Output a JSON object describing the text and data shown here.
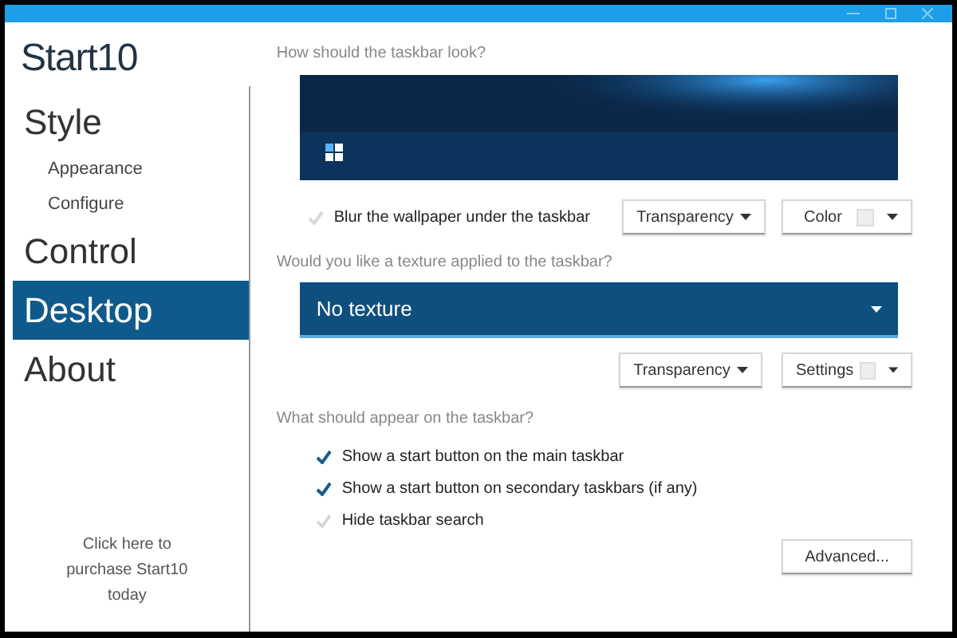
{
  "logo": {
    "text": "Start10"
  },
  "sidebar": {
    "items": [
      {
        "label": "Style",
        "selected": false,
        "children": [
          {
            "label": "Appearance"
          },
          {
            "label": "Configure"
          }
        ]
      },
      {
        "label": "Control",
        "selected": false
      },
      {
        "label": "Desktop",
        "selected": true
      },
      {
        "label": "About",
        "selected": false
      }
    ],
    "purchase_link": "Click here to purchase Start10 today"
  },
  "sections": [
    {
      "question": "How should the taskbar look?",
      "preview": {
        "kind": "picture"
      },
      "options": [
        {
          "label": "Blur the wallpaper under the taskbar",
          "checked": false
        }
      ],
      "dropdowns": [
        {
          "label": "Transparency",
          "swatch": false
        },
        {
          "label": "Color",
          "swatch": true
        }
      ]
    },
    {
      "question": "Would you like a texture applied to the taskbar?",
      "select": {
        "value": "No texture"
      },
      "dropdowns": [
        {
          "label": "Transparency",
          "swatch": false
        },
        {
          "label": "Settings",
          "swatch": true
        }
      ]
    },
    {
      "question": "What should appear on the taskbar?",
      "options": [
        {
          "label": "Show a start button on the main taskbar",
          "checked": true
        },
        {
          "label": "Show a start button on secondary taskbars (if any)",
          "checked": true
        },
        {
          "label": "Hide taskbar search",
          "checked": false
        }
      ],
      "button": "Advanced..."
    }
  ]
}
